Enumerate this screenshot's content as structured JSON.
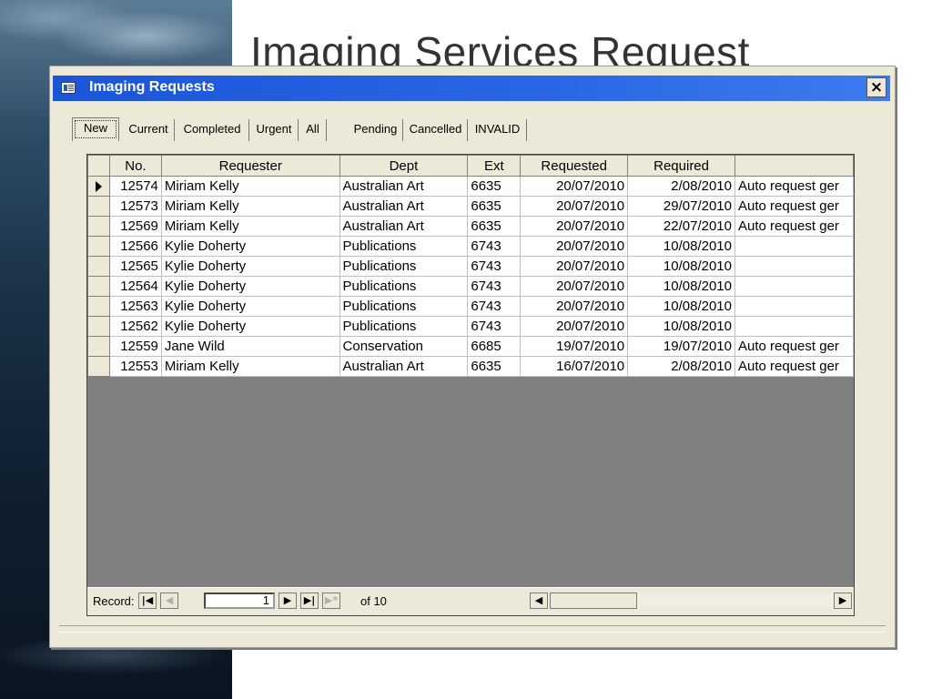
{
  "slide": {
    "title": "Imaging Services Request"
  },
  "window": {
    "title": "Imaging Requests",
    "close_label": "×"
  },
  "tabs": [
    "New",
    "Current",
    "Completed",
    "Urgent",
    "All",
    "Pending",
    "Cancelled",
    "INVALID"
  ],
  "active_tab": "New",
  "grid": {
    "columns": [
      "No.",
      "Requester",
      "Dept",
      "Ext",
      "Requested",
      "Required",
      ""
    ],
    "rows": [
      {
        "no": "12574",
        "requester": "Miriam Kelly",
        "dept": "Australian Art",
        "ext": "6635",
        "requested": "20/07/2010",
        "required": "2/08/2010",
        "notes": "Auto request ger"
      },
      {
        "no": "12573",
        "requester": "Miriam Kelly",
        "dept": "Australian Art",
        "ext": "6635",
        "requested": "20/07/2010",
        "required": "29/07/2010",
        "notes": "Auto request ger"
      },
      {
        "no": "12569",
        "requester": "Miriam Kelly",
        "dept": "Australian Art",
        "ext": "6635",
        "requested": "20/07/2010",
        "required": "22/07/2010",
        "notes": "Auto request ger"
      },
      {
        "no": "12566",
        "requester": "Kylie Doherty",
        "dept": "Publications",
        "ext": "6743",
        "requested": "20/07/2010",
        "required": "10/08/2010",
        "notes": ""
      },
      {
        "no": "12565",
        "requester": "Kylie Doherty",
        "dept": "Publications",
        "ext": "6743",
        "requested": "20/07/2010",
        "required": "10/08/2010",
        "notes": ""
      },
      {
        "no": "12564",
        "requester": "Kylie Doherty",
        "dept": "Publications",
        "ext": "6743",
        "requested": "20/07/2010",
        "required": "10/08/2010",
        "notes": ""
      },
      {
        "no": "12563",
        "requester": "Kylie Doherty",
        "dept": "Publications",
        "ext": "6743",
        "requested": "20/07/2010",
        "required": "10/08/2010",
        "notes": ""
      },
      {
        "no": "12562",
        "requester": "Kylie Doherty",
        "dept": "Publications",
        "ext": "6743",
        "requested": "20/07/2010",
        "required": "10/08/2010",
        "notes": ""
      },
      {
        "no": "12559",
        "requester": "Jane Wild",
        "dept": "Conservation",
        "ext": "6685",
        "requested": "19/07/2010",
        "required": "19/07/2010",
        "notes": "Auto request ger"
      },
      {
        "no": "12553",
        "requester": "Miriam Kelly",
        "dept": "Australian Art",
        "ext": "6635",
        "requested": "16/07/2010",
        "required": "2/08/2010",
        "notes": "Auto request ger"
      }
    ],
    "selected_row": 0
  },
  "navigator": {
    "label": "Record:",
    "current_record": "1",
    "of_label": "of 10",
    "first_icon": "first-record-icon",
    "prev_icon": "previous-record-icon",
    "next_icon": "next-record-icon",
    "last_icon": "last-record-icon",
    "new_icon": "new-record-icon"
  },
  "colors": {
    "titlebar": "#1b55d8",
    "window_bg": "#ece9d8",
    "grid_empty": "#808080"
  }
}
